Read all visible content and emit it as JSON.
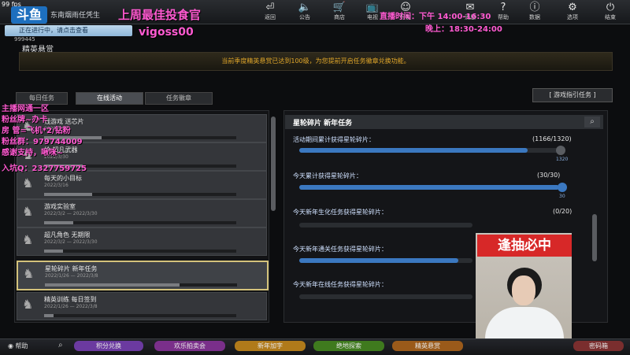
{
  "top": {
    "fps": "99 fps",
    "logo": "斗鱼",
    "subtitle": "东南烟雨任凭生",
    "stream_title": "上周最佳投食官",
    "stream_name": "vigoss00",
    "live_time_1": "直播时间：下午 14:00-16:30",
    "live_time_2": "晚上：18:30-24:00",
    "icons": [
      {
        "label": "返回",
        "icon": "return-icon",
        "glyph": "⏎"
      },
      {
        "label": "公告",
        "icon": "announce-icon",
        "glyph": "🔈"
      },
      {
        "label": "商店",
        "icon": "shop-icon",
        "glyph": "🛒"
      },
      {
        "label": "电视",
        "icon": "tv-icon",
        "glyph": "📺"
      },
      {
        "label": "好友",
        "icon": "friends-icon",
        "glyph": "☺"
      },
      {
        "label": "消息",
        "icon": "message-icon",
        "glyph": "✉"
      },
      {
        "label": "帮助",
        "icon": "help-icon",
        "glyph": "?"
      },
      {
        "label": "数据",
        "icon": "data-icon",
        "glyph": "ⓘ"
      },
      {
        "label": "选项",
        "icon": "options-icon",
        "glyph": "⚙"
      },
      {
        "label": "结束",
        "icon": "power-icon",
        "glyph": "⏻"
      }
    ]
  },
  "notification": {
    "text": "正在进行中，请点击查看",
    "number": "999445"
  },
  "section_title": "精英悬赏",
  "banner": "当前季度精英悬赏已达到100级，为您提前开启任务徽章兑换功能。",
  "tabs": [
    {
      "label": "每日任务",
      "active": false
    },
    {
      "label": "在线活动",
      "active": true
    },
    {
      "label": "任务徽章",
      "active": false
    }
  ],
  "guide_button": "[ 游戏指引任务 ]",
  "left_items": [
    {
      "name": "线游戏 送芯片",
      "date": "2022/3/16",
      "progress": 0.3
    },
    {
      "name": "给 超凡武器",
      "date": "2022/3/30",
      "progress": 0.2
    },
    {
      "name": "每天的小目标",
      "date": "2022/3/16",
      "progress": 0.25
    },
    {
      "name": "游戏实验室",
      "date": "2022/3/2 — 2022/3/30",
      "progress": 0.15
    },
    {
      "name": "超凡角色 无期限",
      "date": "2022/3/2 — 2022/3/30",
      "progress": 0.1
    },
    {
      "name": "星轮碎片 新年任务",
      "date": "2022/1/26 — 2022/3/8",
      "progress": 0.7,
      "selected": true
    },
    {
      "name": "精英训练 每日签到",
      "date": "2022/1/26 — 2022/3/8",
      "progress": 0.05
    }
  ],
  "chat": [
    "主播网通一区",
    "粉丝牌~办卡",
    "房  管=飞机*2/钻粉",
    "粉丝群：979744009",
    "感谢支持，啾咪~",
    "入坑Q：2327759725"
  ],
  "right_panel": {
    "title": "星轮碎片  新年任务",
    "tasks": [
      {
        "label": "活动期间累计获得星轮碎片：",
        "count": "(1166/1320)",
        "progress": 0.883,
        "target": "1320"
      },
      {
        "label": "今天累计获得星轮碎片：",
        "count": "(30/30)",
        "progress": 1.0,
        "target": "30"
      },
      {
        "label": "今天新年生化任务获得星轮碎片：",
        "count": "(0/20)",
        "progress": 0.0,
        "target": ""
      },
      {
        "label": "今天新年通关任务获得星轮碎片：",
        "count": "",
        "progress": 0.55,
        "target": ""
      },
      {
        "label": "今天新年在线任务获得星轮碎片：",
        "count": "",
        "progress": 0.0,
        "target": ""
      }
    ]
  },
  "cam": {
    "banner": "逢抽必中"
  },
  "bottom": {
    "help": "帮助",
    "buttons": [
      {
        "label": "积分兑换",
        "color": "#6b3aa0"
      },
      {
        "label": "欢乐拍卖会",
        "color": "#7a2f8a"
      },
      {
        "label": "新年加字",
        "color": "#b07a1a"
      },
      {
        "label": "绝地探索",
        "color": "#3f7a1e"
      },
      {
        "label": "精英悬赏",
        "color": "#9a5a1a"
      },
      {
        "label": "密码箱",
        "color": "#7a2e2e"
      }
    ]
  }
}
